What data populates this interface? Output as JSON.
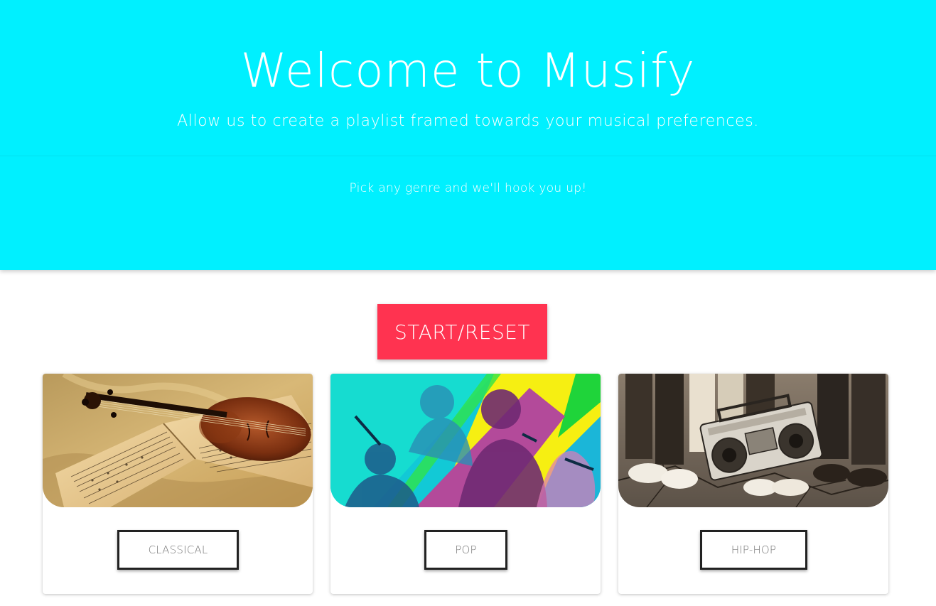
{
  "hero": {
    "title": "Welcome to Musify",
    "subtitle": "Allow us to create a playlist framed towards your musical preferences.",
    "tagline": "Pick any genre and we'll hook you up!",
    "background_color": "#00f0ff"
  },
  "controls": {
    "start_reset_label": "START/RESET",
    "start_reset_color": "#ff3350"
  },
  "genres": [
    {
      "label": "CLASSICAL",
      "image": "violin-and-sheet-music-image"
    },
    {
      "label": "POP",
      "image": "pop-artists-collage-image"
    },
    {
      "label": "HIP-HOP",
      "image": "boombox-and-sneakers-image"
    }
  ]
}
